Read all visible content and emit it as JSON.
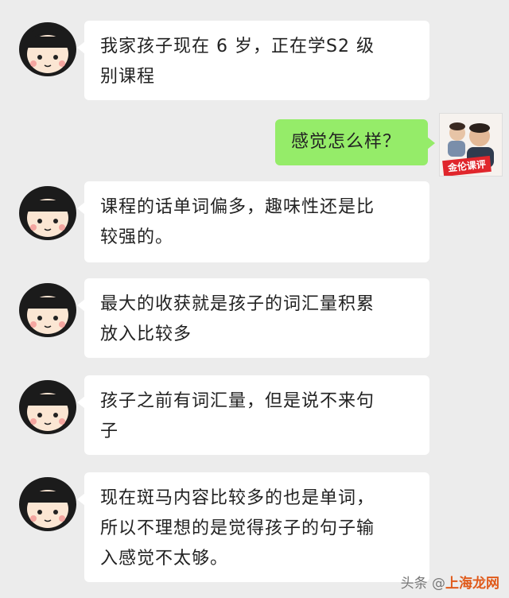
{
  "messages": [
    {
      "side": "left",
      "text_lines": [
        "我家孩子现在 6 岁，正在学S2 级",
        "别课程"
      ]
    },
    {
      "side": "right",
      "text_lines": [
        "感觉怎么样？"
      ],
      "avatar_badge": "金伦课评"
    },
    {
      "side": "left",
      "text_lines": [
        "课程的话单词偏多，趣味性还是比",
        "较强的。"
      ]
    },
    {
      "side": "left",
      "text_lines": [
        "最大的收获就是孩子的词汇量积累",
        "放入比较多"
      ]
    },
    {
      "side": "left",
      "text_lines": [
        "孩子之前有词汇量，但是说不来句",
        "子"
      ]
    },
    {
      "side": "left",
      "text_lines": [
        "现在斑马内容比较多的也是单词，",
        "所以不理想的是觉得孩子的句子输",
        "入感觉不太够。"
      ]
    }
  ],
  "watermark": {
    "prefix": "头条 @",
    "brand": "上海龙网"
  },
  "colors": {
    "background": "#ececec",
    "left_bubble": "#ffffff",
    "right_bubble": "#95ec69"
  }
}
